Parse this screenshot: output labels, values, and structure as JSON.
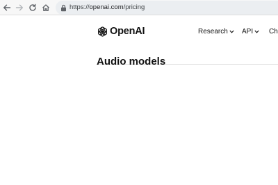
{
  "browser": {
    "url_scheme": "https://",
    "url_host": "openai.com",
    "url_path": "/pricing",
    "icons": [
      "back-icon",
      "forward-icon",
      "reload-icon",
      "home-icon",
      "lock-icon"
    ]
  },
  "header": {
    "logo_text": "OpenAI",
    "nav": [
      {
        "label": "Research"
      },
      {
        "label": "API"
      },
      {
        "label": "Ch"
      }
    ]
  },
  "main": {
    "section_title": "Audio models"
  },
  "colors": {
    "text": "#111111",
    "chrome_bg": "#f7f7f7",
    "omnibox_bg": "#ebeef1",
    "url_muted": "#3c4043"
  }
}
